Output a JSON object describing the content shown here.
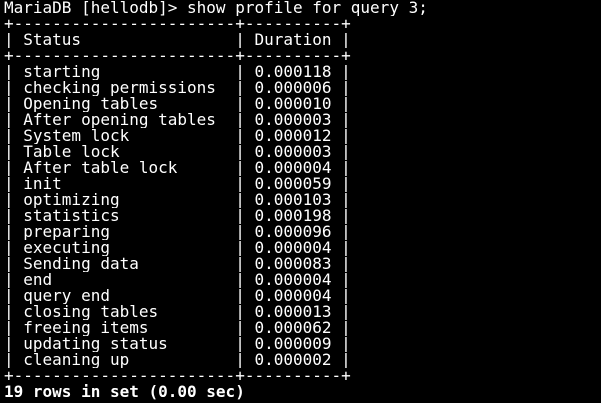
{
  "prompt": {
    "text": "MariaDB [hellodb]> show profile for query 3;"
  },
  "table": {
    "border": "+-----------------------+----------+",
    "header": "| Status                | Duration |",
    "rows": [
      "| starting              | 0.000118 |",
      "| checking permissions  | 0.000006 |",
      "| Opening tables        | 0.000010 |",
      "| After opening tables  | 0.000003 |",
      "| System lock           | 0.000012 |",
      "| Table lock            | 0.000003 |",
      "| After table lock      | 0.000004 |",
      "| init                  | 0.000059 |",
      "| optimizing            | 0.000103 |",
      "| statistics            | 0.000198 |",
      "| preparing             | 0.000096 |",
      "| executing             | 0.000004 |",
      "| Sending data          | 0.000083 |",
      "| end                   | 0.000004 |",
      "| query end             | 0.000004 |",
      "| closing tables        | 0.000013 |",
      "| freeing items         | 0.000062 |",
      "| updating status       | 0.000009 |",
      "| cleaning up           | 0.000002 |"
    ]
  },
  "footer": {
    "text": "19 rows in set (0.00 sec)"
  },
  "colors": {
    "background": "#000000",
    "foreground": "#ffffff"
  }
}
